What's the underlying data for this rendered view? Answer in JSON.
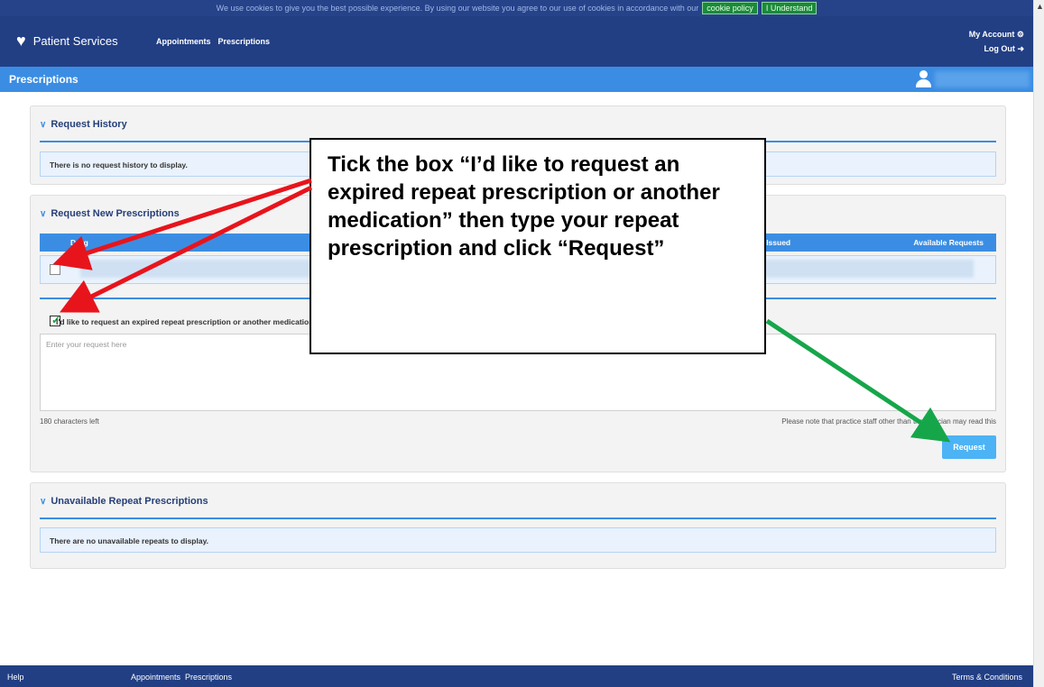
{
  "cookie": {
    "text": "We use cookies to give you the best possible experience. By using our website you agree to our use of cookies in accordance with our",
    "policy_label": "cookie policy",
    "understand_label": "I Understand"
  },
  "header": {
    "brand": "Patient Services",
    "nav": [
      "Appointments",
      "Prescriptions"
    ],
    "my_account": "My Account",
    "log_out": "Log Out"
  },
  "page": {
    "title": "Prescriptions"
  },
  "request_history": {
    "heading": "Request History",
    "empty_text": "There is no request history to display."
  },
  "request_new": {
    "heading": "Request New Prescriptions",
    "columns": {
      "first": "Drug",
      "issued": "t Issued",
      "available": "Available Requests"
    },
    "checkbox_label": "I'd like to request an expired repeat prescription or another medication",
    "input_placeholder": "Enter your request here",
    "chars_left": "180 characters left",
    "staff_note": "Please note that practice staff other than the clinician may read this",
    "request_button": "Request"
  },
  "unavailable": {
    "heading": "Unavailable Repeat Prescriptions",
    "empty_text": "There are no unavailable repeats to display."
  },
  "footer": {
    "help": "Help",
    "nav": [
      "Appointments",
      "Prescriptions"
    ],
    "terms": "Terms & Conditions"
  },
  "callout": {
    "text": "Tick the box “I’d like to request an expired repeat prescription or another medication” then type your repeat prescription and click “Request”"
  },
  "colors": {
    "header": "#223f84",
    "accent": "#3b8de3",
    "red_arrow": "#e8141c",
    "green_arrow": "#16a64a"
  }
}
